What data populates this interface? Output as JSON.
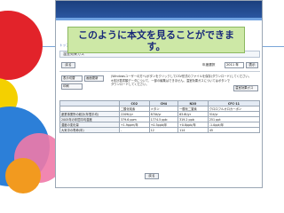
{
  "banner": {
    "title": ""
  },
  "nav": {
    "breadcrumb": "トップ > 省エネ法対象 > 事業者様 > エネルギー報告"
  },
  "page": {
    "heading": "温室効果ガス"
  },
  "controls": {
    "back_label": "戻る",
    "year_label": "年度選択",
    "year_value": "2011 年",
    "show_label": "表示"
  },
  "tools": {
    "btn1": "表示切替",
    "btn2": "画面更新",
    "btn3": "印刷",
    "btn4": "温室効果ガス"
  },
  "notes": {
    "line1": "(Windowsユーザーの方へ)ボタンをクリックしてCSV形式のファイルを保存(ダウンロード)してください。",
    "line2": "※本計算書類データについて、一部の編集はできません。温室効果ガスについてはボタンで",
    "line3": "ダウンロードしてください。"
  },
  "table": {
    "headers": [
      "",
      "CO2",
      "CH4",
      "N2O",
      "CFC-11"
    ],
    "subheaders": [
      "",
      "二酸化炭素",
      "メタン",
      "一酸化二窒素",
      "クロロフルオロカーボン"
    ],
    "rows": [
      [
        "産業事業所の総計(年間平均)",
        "2209t/yr",
        "870t/yr",
        "63.6t/yr",
        "51t/yr"
      ],
      [
        "2005年の年間平均濃度",
        "379.6 ppm",
        "1774.5 ppb",
        "319.2 ppb",
        "251 ppt"
      ],
      [
        "濃度の変化量",
        "+1.9ppm/年",
        "+0.5ppb/年",
        "+0.8ppb/年",
        "-1.0ppt/年"
      ],
      [
        "大気中の寿命(年)",
        "-",
        "12",
        "114",
        "45"
      ]
    ]
  },
  "callout": {
    "line1": "このように本文を見ることができま",
    "line2": "す。"
  }
}
